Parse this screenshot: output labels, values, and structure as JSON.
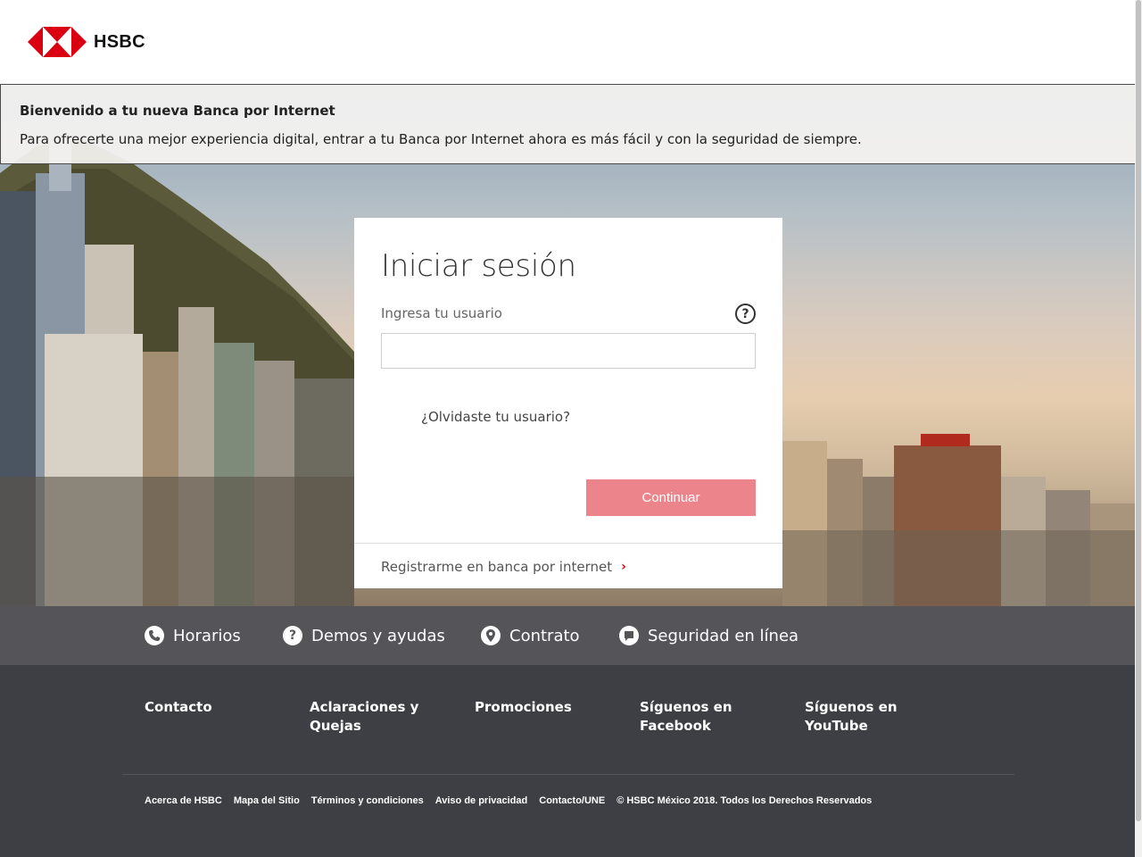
{
  "brand": {
    "name": "HSBC",
    "logo_colors": [
      "#db0011",
      "#ffffff"
    ]
  },
  "banner": {
    "title": "Bienvenido a tu nueva Banca por Internet",
    "text": "Para ofrecerte una mejor experiencia digital, entrar a tu Banca por Internet ahora es más fácil y con la seguridad de siempre."
  },
  "login": {
    "title": "Iniciar sesión",
    "user_label": "Ingresa tu usuario",
    "help_symbol": "?",
    "user_value": "",
    "forgot_link": "¿Olvidaste tu usuario?",
    "continue_label": "Continuar",
    "register_link": "Registrarme en banca por internet",
    "register_chevron": "›",
    "continue_color": "#ec848c"
  },
  "quick_links": [
    {
      "label": "Horarios",
      "icon": "phone-icon"
    },
    {
      "label": "Demos y ayudas",
      "icon": "help-icon"
    },
    {
      "label": "Contrato",
      "icon": "location-pin-icon"
    },
    {
      "label": "Seguridad en línea",
      "icon": "chat-bubble-icon"
    }
  ],
  "footer": {
    "columns": [
      "Contacto",
      "Aclaraciones y Quejas",
      "Promociones",
      "Síguenos en Facebook",
      "Síguenos en YouTube"
    ],
    "bottom_links": [
      "Acerca de HSBC",
      "Mapa del Sitio",
      "Términos y condiciones",
      "Aviso de privacidad",
      "Contacto/UNE"
    ],
    "copyright": "© HSBC México 2018. Todos los Derechos Reservados"
  },
  "colors": {
    "brand_red": "#db0011",
    "quickbar_bg": "#545459",
    "footer_bg": "#3e3f44"
  }
}
